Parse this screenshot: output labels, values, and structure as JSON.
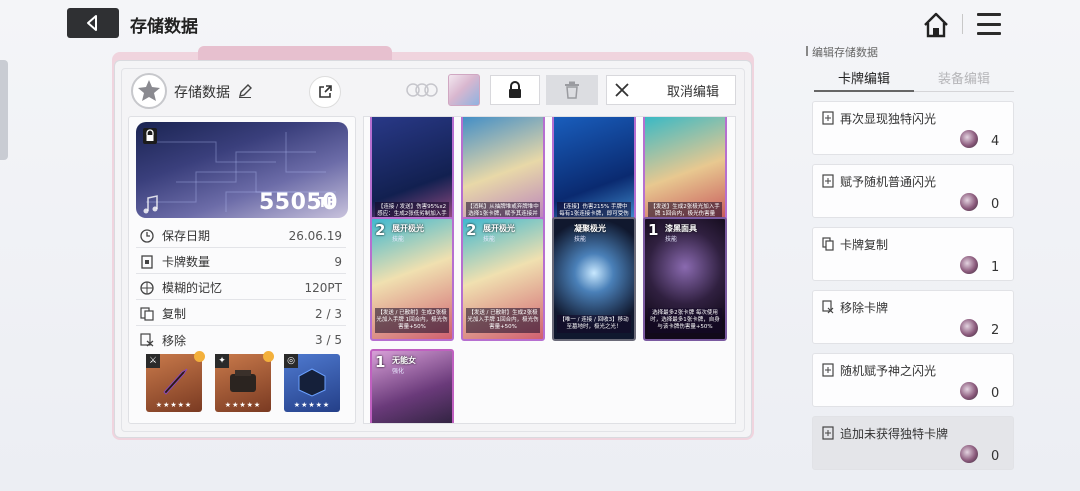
{
  "header": {
    "title": "存储数据",
    "back_icon": "chevron-left-icon",
    "home_icon": "home-icon",
    "menu_icon": "hamburger-menu-icon"
  },
  "save": {
    "name": "存储数据",
    "cancel_edit_label": "取消编辑",
    "size_value": "55050",
    "size_unit": "TB"
  },
  "stats": [
    {
      "label": "保存日期",
      "value": "26.06.19"
    },
    {
      "label": "卡牌数量",
      "value": "9"
    },
    {
      "label": "模糊的记忆",
      "value": "120PT"
    },
    {
      "label": "复制",
      "value": "2 / 3"
    },
    {
      "label": "移除",
      "value": "3 / 5"
    }
  ],
  "equipment": [
    {
      "type_icon": "sword-icon",
      "stars": "★★★★★"
    },
    {
      "type_icon": "armor-icon",
      "stars": "★★★★★"
    },
    {
      "type_icon": "ring-icon",
      "stars": "★★★★★"
    }
  ],
  "cards": [
    {
      "cost": "",
      "name": "",
      "kind": "",
      "desc": "【连接 / 发送】伤害95%x2 感应：生成2张低劣制加入手牌 随机己方对敌人发动合击"
    },
    {
      "cost": "",
      "name": "",
      "kind": "",
      "desc": "【消耗】从抽牌堆或弃牌堆中选择1张卡牌，赋予其连接并将其移动至手牌"
    },
    {
      "cost": "",
      "name": "",
      "kind": "",
      "desc": "【连接】伤害215% 手牌中每有1张连接卡牌，即可受伤害量+180%"
    },
    {
      "cost": "",
      "name": "",
      "kind": "",
      "desc": "【发送】生成2张极光加入手牌 1回合内，极光伤害量+50%"
    },
    {
      "cost": "2",
      "name": "展开极光",
      "kind": "技能",
      "desc": "【发送 / 已散射】生成2张极光加入手牌 1回合内，极光伤害量+50%"
    },
    {
      "cost": "2",
      "name": "展开极光",
      "kind": "技能",
      "desc": "【发送 / 已散射】生成2张极光加入手牌 1回合内，极光伤害量+50%"
    },
    {
      "cost": "",
      "name": "凝聚极光",
      "kind": "技能",
      "desc": "【唯一 / 连接 / 回收3】移动至墓地时，极光之光！"
    },
    {
      "cost": "1",
      "name": "漆黑面具",
      "kind": "技能",
      "desc": "选择最多2张卡牌 每次使用时，选择最多1张卡牌，自身与该卡牌伤害量+50%"
    },
    {
      "cost": "1",
      "name": "无能女",
      "kind": "强化",
      "desc": ""
    }
  ],
  "right_panel": {
    "heading": "编辑存储数据",
    "tab_cards": "卡牌编辑",
    "tab_equipment": "装备编辑",
    "options": [
      {
        "label": "再次显现独特闪光",
        "count": "4",
        "icon": "card-icon"
      },
      {
        "label": "赋予随机普通闪光",
        "count": "0",
        "icon": "card-icon"
      },
      {
        "label": "卡牌复制",
        "count": "1",
        "icon": "copy-icon"
      },
      {
        "label": "移除卡牌",
        "count": "2",
        "icon": "remove-card-icon"
      },
      {
        "label": "随机赋予神之闪光",
        "count": "0",
        "icon": "card-icon"
      },
      {
        "label": "追加未获得独特卡牌",
        "count": "0",
        "icon": "card-icon"
      }
    ]
  }
}
